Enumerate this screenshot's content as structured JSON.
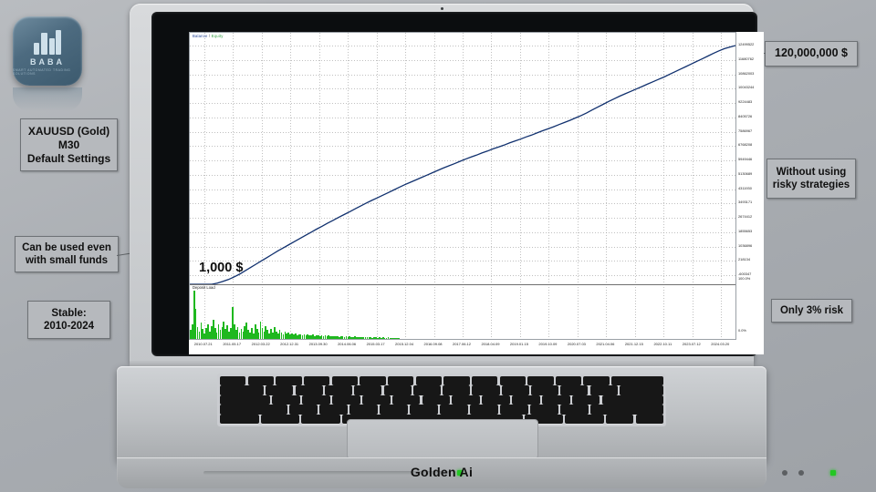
{
  "brand": {
    "logo_name": "BABA",
    "logo_tagline": "SMART AUTOMATED TRADING SOLUTIONS",
    "laptop_label": "Golden Ai"
  },
  "callouts": [
    {
      "id": "symbol",
      "lines": [
        "XAUUSD (Gold)",
        "M30",
        "Default Settings"
      ]
    },
    {
      "id": "funds",
      "lines": [
        "Can be used even",
        "with small funds"
      ]
    },
    {
      "id": "stable",
      "lines": [
        "Stable:",
        "2010-2024"
      ]
    },
    {
      "id": "amount",
      "lines": [
        "120,000,000 $"
      ]
    },
    {
      "id": "risky",
      "lines": [
        "Without using",
        "risky strategies"
      ]
    },
    {
      "id": "risk",
      "lines": [
        "Only 3% risk"
      ]
    }
  ],
  "chart_overlay": {
    "start_balance_label": "1,000 $"
  },
  "chart_data": {
    "type": "line",
    "title": "Balance / Equity",
    "legend": {
      "balance": "Balance",
      "separator": "/",
      "equity": "Equity",
      "position": "top-left"
    },
    "subseries_label": "Deposit Load",
    "xlabel": "",
    "ylabel": "",
    "grid": true,
    "x_tick_labels": [
      "2010.07.21",
      "2011.05.17",
      "2012.03.22",
      "2012.12.31",
      "2013.09.30",
      "2014.06.06",
      "2015.03.17",
      "2015.12.04",
      "2016.09.08",
      "2017.06.12",
      "2018.04.09",
      "2019.01.15",
      "2019.10.09",
      "2020.07.03",
      "2021.04.06",
      "2021.12.15",
      "2022.10.11",
      "2023.07.12",
      "2024.03.20"
    ],
    "y_tick_labels": [
      "12499522",
      "11680762",
      "10862003",
      "10043244",
      "9224483",
      "8405726",
      "7586967",
      "6768208",
      "5949446",
      "5130689",
      "4311930",
      "3493171",
      "2674412",
      "1855653",
      "1036896",
      "218134",
      "-600347"
    ],
    "y_axis_percent_labels": [
      "100.0%",
      "0.0%"
    ],
    "ylim": [
      -600347,
      12499522
    ],
    "series": [
      {
        "name": "Balance",
        "color": "#10306e",
        "points": [
          0.0,
          0.0,
          0.0,
          0.0,
          0.0,
          0.005,
          0.012,
          0.02,
          0.03,
          0.042,
          0.056,
          0.07,
          0.084,
          0.098,
          0.112,
          0.126,
          0.14,
          0.153,
          0.166,
          0.179,
          0.192,
          0.205,
          0.218,
          0.231,
          0.243,
          0.256,
          0.268,
          0.28,
          0.292,
          0.304,
          0.316,
          0.328,
          0.34,
          0.351,
          0.362,
          0.373,
          0.384,
          0.395,
          0.406,
          0.417,
          0.427,
          0.437,
          0.447,
          0.457,
          0.467,
          0.477,
          0.487,
          0.496,
          0.505,
          0.515,
          0.524,
          0.533,
          0.541,
          0.55,
          0.558,
          0.567,
          0.575,
          0.583,
          0.592,
          0.6,
          0.608,
          0.617,
          0.625,
          0.634,
          0.643,
          0.651,
          0.66,
          0.669,
          0.678,
          0.687,
          0.697,
          0.707,
          0.718,
          0.73,
          0.742,
          0.754,
          0.766,
          0.777,
          0.788,
          0.798,
          0.808,
          0.818,
          0.828,
          0.838,
          0.848,
          0.858,
          0.868,
          0.879,
          0.89,
          0.901,
          0.912,
          0.923,
          0.934,
          0.945,
          0.956,
          0.967,
          0.978,
          0.987,
          0.994,
          1.0
        ]
      },
      {
        "name": "Deposit Load",
        "color": "#1fb81f",
        "values": [
          0.18,
          0.3,
          1.0,
          0.62,
          0.24,
          0.16,
          0.34,
          0.2,
          0.12,
          0.22,
          0.3,
          0.16,
          0.26,
          0.4,
          0.22,
          0.14,
          0.3,
          0.18,
          0.24,
          0.36,
          0.2,
          0.28,
          0.16,
          0.22,
          0.66,
          0.3,
          0.18,
          0.24,
          0.14,
          0.2,
          0.16,
          0.26,
          0.34,
          0.18,
          0.14,
          0.22,
          0.12,
          0.3,
          0.2,
          0.14,
          0.36,
          0.22,
          0.16,
          0.26,
          0.18,
          0.12,
          0.2,
          0.14,
          0.24,
          0.16,
          0.12,
          0.18,
          0.14,
          0.1,
          0.16,
          0.12,
          0.14,
          0.1,
          0.12,
          0.09,
          0.11,
          0.08,
          0.1,
          0.09,
          0.08,
          0.1,
          0.07,
          0.09,
          0.08,
          0.07,
          0.09,
          0.06,
          0.08,
          0.07,
          0.06,
          0.08,
          0.06,
          0.07,
          0.05,
          0.07,
          0.06,
          0.05,
          0.06,
          0.05,
          0.06,
          0.04,
          0.06,
          0.05,
          0.04,
          0.05,
          0.04,
          0.05,
          0.04,
          0.03,
          0.05,
          0.04,
          0.03,
          0.04,
          0.03,
          0.04,
          0.03,
          0.04,
          0.03,
          0.03,
          0.02,
          0.03,
          0.03,
          0.02,
          0.03,
          0.02,
          0.03,
          0.02,
          0.02,
          0.03,
          0.02,
          0.02,
          0.02,
          0.02,
          0.02,
          0.02
        ]
      }
    ]
  }
}
